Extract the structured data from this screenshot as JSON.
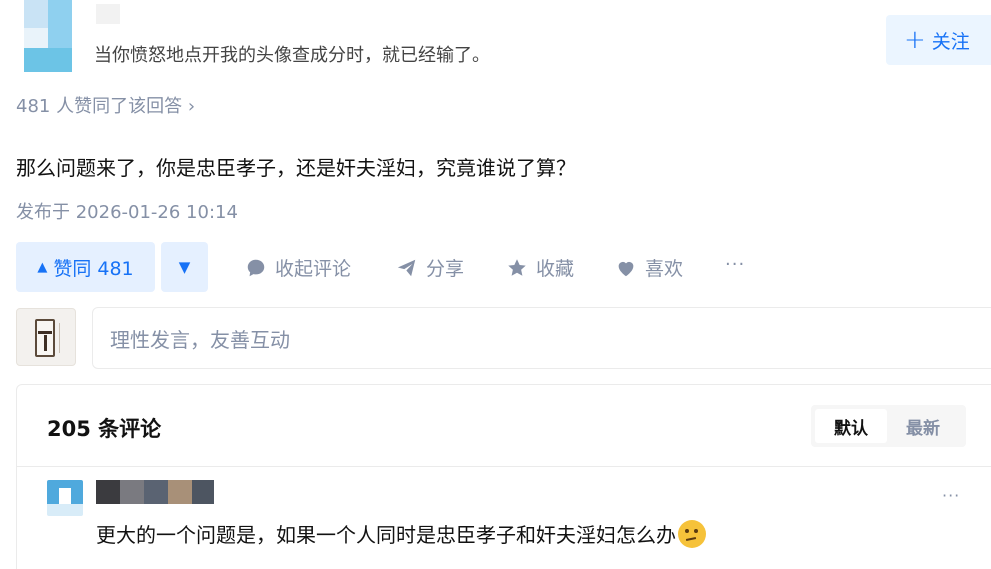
{
  "author": {
    "bio": "当你愤怒地点开我的头像查成分时，就已经输了。",
    "follow_label": "关注"
  },
  "answer": {
    "voters_text": "481 人赞同了该回答",
    "content": "那么问题来了，你是忠臣孝子，还是奸夫淫妇，究竟谁说了算？",
    "published": "发布于 2026-01-26 10:14"
  },
  "actions": {
    "upvote_label": "赞同 481",
    "collapse_comments": "收起评论",
    "share": "分享",
    "favorite": "收藏",
    "like": "喜欢",
    "more": "···"
  },
  "comment_box": {
    "placeholder": "理性发言，友善互动"
  },
  "comments": {
    "count_label": "205 条评论",
    "sort": [
      "默认",
      "最新"
    ],
    "items": [
      {
        "text": "更大的一个问题是，如果一个人同时是忠臣孝子和奸夫淫妇怎么办",
        "emoji": "thinking-face-emoji",
        "more": "···"
      }
    ]
  },
  "colors": {
    "accent": "#1772f6",
    "accent_bg": "#ebf5ff",
    "muted": "#8590a6",
    "text": "#121212"
  }
}
